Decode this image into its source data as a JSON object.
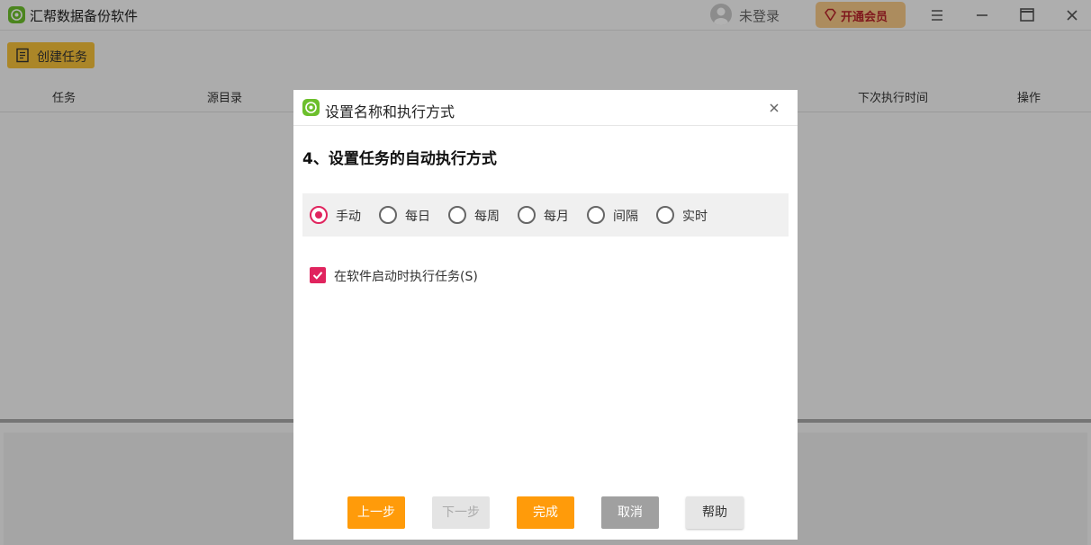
{
  "app": {
    "title": "汇帮数据备份软件",
    "user_status": "未登录",
    "vip_label": "开通会员"
  },
  "toolbar": {
    "create_task_label": "创建任务"
  },
  "table": {
    "columns": [
      "任务",
      "源目录",
      "下次执行时间",
      "操作"
    ]
  },
  "dialog": {
    "title": "设置名称和执行方式",
    "step_title": "4、设置任务的自动执行方式",
    "modes": [
      {
        "label": "手动",
        "selected": true
      },
      {
        "label": "每日",
        "selected": false
      },
      {
        "label": "每周",
        "selected": false
      },
      {
        "label": "每月",
        "selected": false
      },
      {
        "label": "间隔",
        "selected": false
      },
      {
        "label": "实时",
        "selected": false
      }
    ],
    "run_on_startup": {
      "label": "在软件启动时执行任务(S)",
      "checked": true
    },
    "buttons": {
      "prev": "上一步",
      "next": "下一步",
      "done": "完成",
      "cancel": "取消",
      "help": "帮助"
    }
  },
  "colors": {
    "accent": "#e0245e",
    "primary_button": "#ff9b0a",
    "create_button": "#f5c03a",
    "logo_green": "#6cbf2c",
    "vip_bg": "#f7c987"
  }
}
